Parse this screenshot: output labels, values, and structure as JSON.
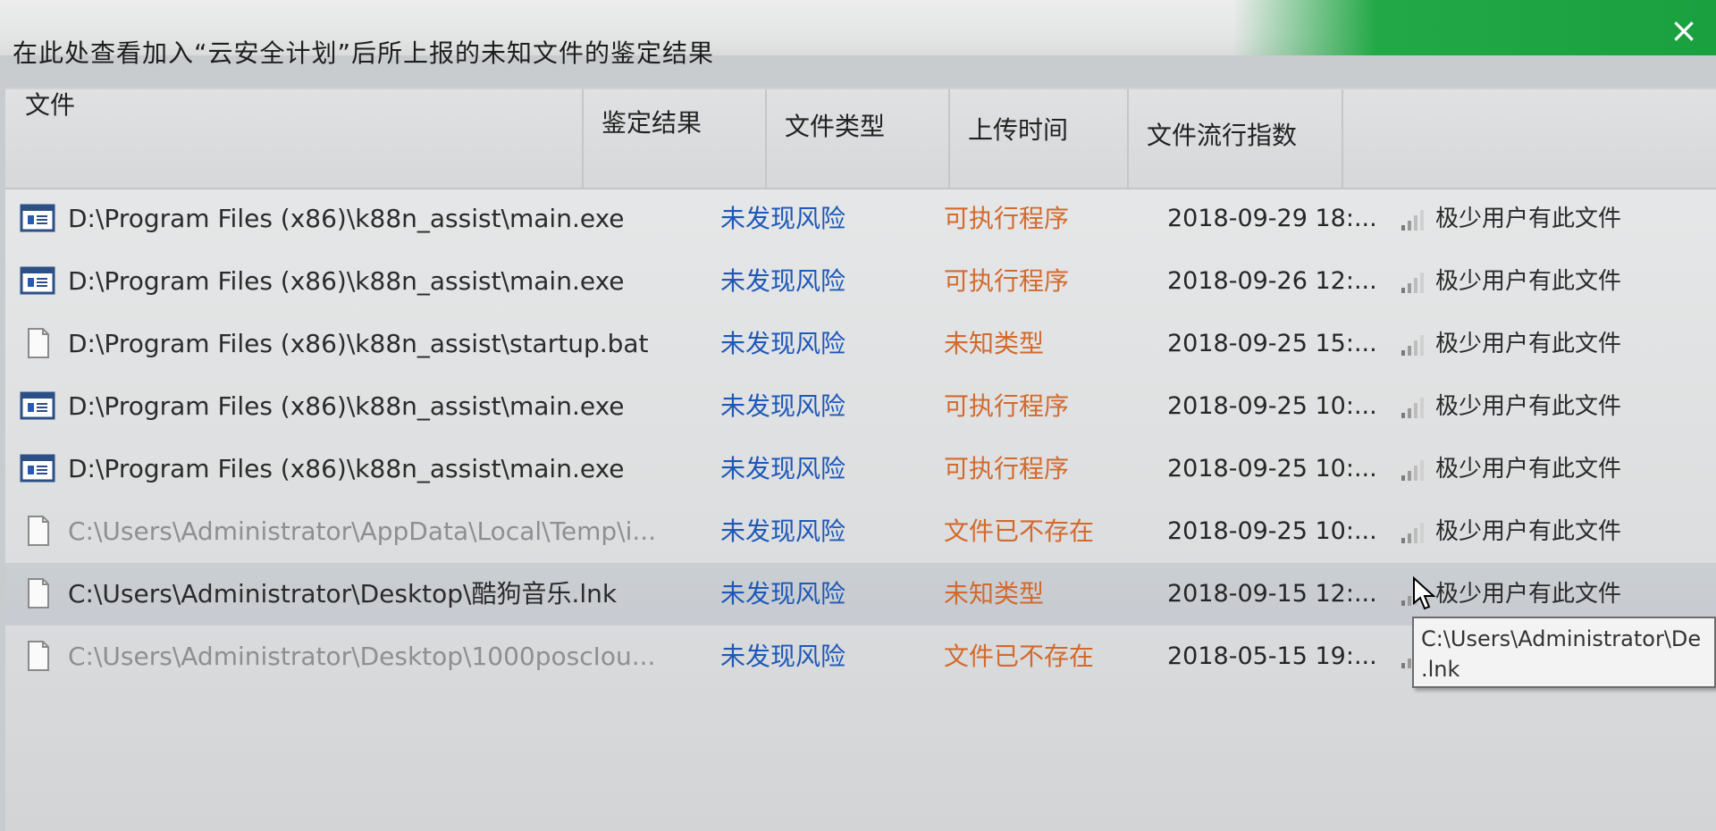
{
  "window": {
    "hint": "在此处查看加入“云安全计划”后所上报的未知文件的鉴定结果",
    "close_label": "×",
    "accent_color": "#1aa03f"
  },
  "table": {
    "headers": [
      "文件",
      "鉴定结果",
      "文件类型",
      "上传时间",
      "文件流行指数"
    ],
    "rows": [
      {
        "icon": "exe-file-icon",
        "path": "D:\\Program Files (x86)\\k88n_assist\\main.exe",
        "result": "未发现风险",
        "type": "可执行程序",
        "time": "2018-09-29 18:...",
        "popularity": "极少用户有此文件"
      },
      {
        "icon": "exe-file-icon",
        "path": "D:\\Program Files (x86)\\k88n_assist\\main.exe",
        "result": "未发现风险",
        "type": "可执行程序",
        "time": "2018-09-26 12:...",
        "popularity": "极少用户有此文件"
      },
      {
        "icon": "blank-file-icon",
        "path": "D:\\Program Files (x86)\\k88n_assist\\startup.bat",
        "result": "未发现风险",
        "type": "未知类型",
        "time": "2018-09-25 15:...",
        "popularity": "极少用户有此文件"
      },
      {
        "icon": "exe-file-icon",
        "path": "D:\\Program Files (x86)\\k88n_assist\\main.exe",
        "result": "未发现风险",
        "type": "可执行程序",
        "time": "2018-09-25 10:...",
        "popularity": "极少用户有此文件"
      },
      {
        "icon": "exe-file-icon",
        "path": "D:\\Program Files (x86)\\k88n_assist\\main.exe",
        "result": "未发现风险",
        "type": "可执行程序",
        "time": "2018-09-25 10:...",
        "popularity": "极少用户有此文件"
      },
      {
        "icon": "blank-file-icon",
        "path": "C:\\Users\\Administrator\\AppData\\Local\\Temp\\i...",
        "result": "未发现风险",
        "type": "文件已不存在",
        "time": "2018-09-25 10:...",
        "popularity": "极少用户有此文件"
      },
      {
        "icon": "blank-file-icon",
        "path": "C:\\Users\\Administrator\\Desktop\\酷狗音乐.lnk",
        "result": "未发现风险",
        "type": "未知类型",
        "time": "2018-09-15 12:...",
        "popularity": "极少用户有此文件"
      },
      {
        "icon": "blank-file-icon",
        "path": "C:\\Users\\Administrator\\Desktop\\1000poscIou...",
        "result": "未发现风险",
        "type": "文件已不存在",
        "time": "2018-05-15 19:...",
        "popularity": ""
      }
    ]
  },
  "tooltip": {
    "line1": "C:\\Users\\Administrator\\De",
    "line2": ".lnk"
  }
}
